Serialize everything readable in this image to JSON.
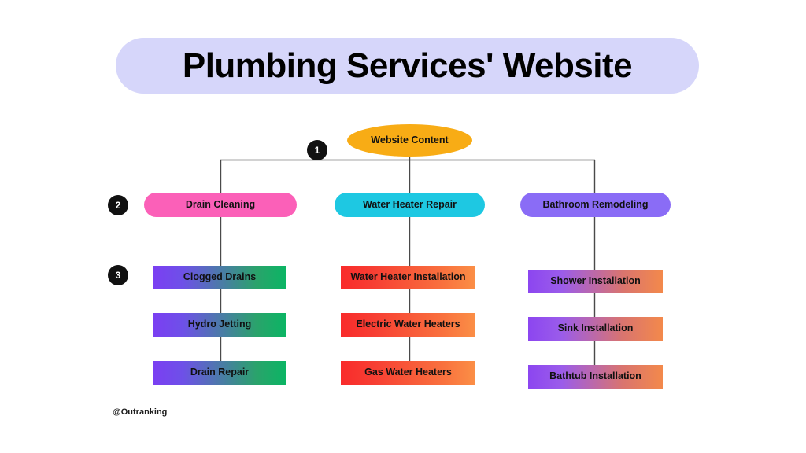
{
  "title": {
    "text": "Plumbing Services' Website",
    "banner_color": "#d6d6fa"
  },
  "footer": {
    "watermark": "@Outranking"
  },
  "badges": [
    {
      "label": "1"
    },
    {
      "label": "2"
    },
    {
      "label": "3"
    }
  ],
  "diagram": {
    "type": "tree",
    "root": {
      "label": "Website Content",
      "color": "#f8ac15",
      "shape": "ellipse"
    },
    "branches": [
      {
        "label": "Drain Cleaning",
        "color": "#fb60b8",
        "children": [
          {
            "label": "Clogged Drains"
          },
          {
            "label": "Hydro Jetting"
          },
          {
            "label": "Drain Repair"
          }
        ]
      },
      {
        "label": "Water Heater Repair",
        "color": "#1ec8e2",
        "children": [
          {
            "label": "Water Heater Installation"
          },
          {
            "label": "Electric Water Heaters"
          },
          {
            "label": "Gas Water Heaters"
          }
        ]
      },
      {
        "label": "Bathroom Remodeling",
        "color": "#8a6cf6",
        "children": [
          {
            "label": "Shower Installation"
          },
          {
            "label": "Sink Installation"
          },
          {
            "label": "Bathtub Installation"
          }
        ]
      }
    ]
  }
}
